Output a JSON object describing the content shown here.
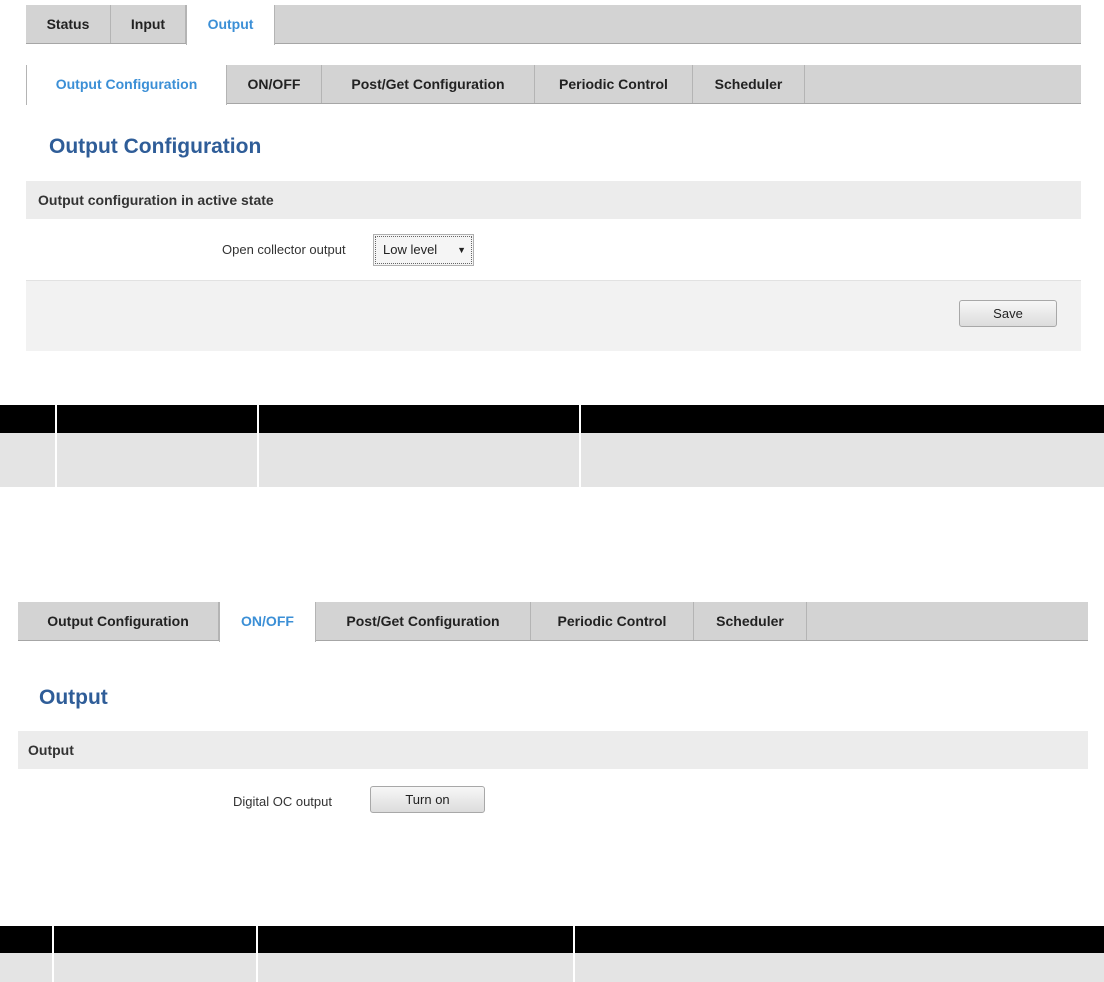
{
  "top_tabs": [
    {
      "label": "Status",
      "active": false
    },
    {
      "label": "Input",
      "active": false
    },
    {
      "label": "Output",
      "active": true
    }
  ],
  "screen1": {
    "sub_tabs": [
      {
        "label": "Output Configuration",
        "active": true
      },
      {
        "label": "ON/OFF",
        "active": false
      },
      {
        "label": "Post/Get Configuration",
        "active": false
      },
      {
        "label": "Periodic Control",
        "active": false
      },
      {
        "label": "Scheduler",
        "active": false
      }
    ],
    "title": "Output Configuration",
    "section_header": "Output configuration in active state",
    "field_label": "Open collector output",
    "select_value": "Low level",
    "save_label": "Save"
  },
  "screen2": {
    "sub_tabs": [
      {
        "label": "Output Configuration",
        "active": false
      },
      {
        "label": "ON/OFF",
        "active": true
      },
      {
        "label": "Post/Get Configuration",
        "active": false
      },
      {
        "label": "Periodic Control",
        "active": false
      },
      {
        "label": "Scheduler",
        "active": false
      }
    ],
    "title": "Output",
    "section_header": "Output",
    "field_label": "Digital OC output",
    "button_label": "Turn on"
  },
  "colors": {
    "accent_blue": "#3b8fd6",
    "title_blue": "#2f5d98",
    "tab_bar": "#d3d3d3",
    "section_bg": "#ececec"
  }
}
